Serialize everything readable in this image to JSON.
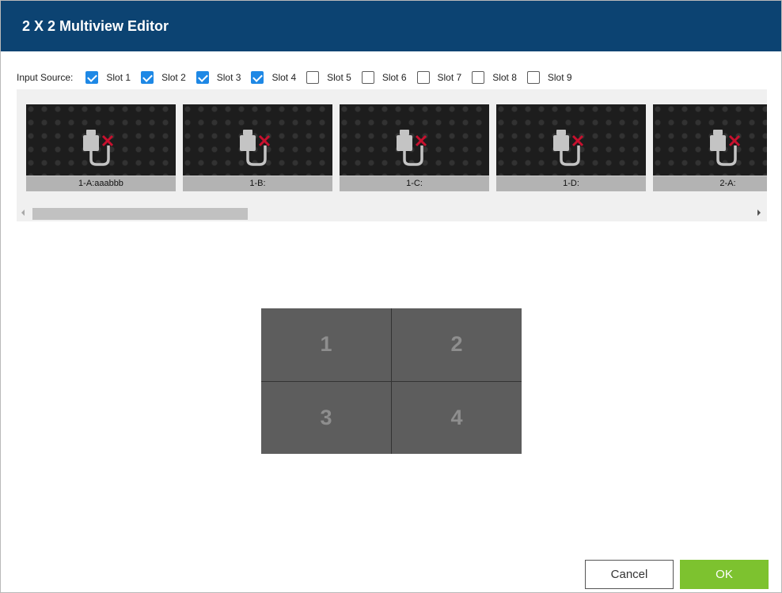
{
  "dialog": {
    "title": "2 X 2 Multiview Editor"
  },
  "input_source": {
    "label": "Input Source:",
    "slots": [
      {
        "label": "Slot 1",
        "checked": true
      },
      {
        "label": "Slot 2",
        "checked": true
      },
      {
        "label": "Slot 3",
        "checked": true
      },
      {
        "label": "Slot 4",
        "checked": true
      },
      {
        "label": "Slot 5",
        "checked": false
      },
      {
        "label": "Slot 6",
        "checked": false
      },
      {
        "label": "Slot 7",
        "checked": false
      },
      {
        "label": "Slot 8",
        "checked": false
      },
      {
        "label": "Slot 9",
        "checked": false
      }
    ]
  },
  "sources": [
    {
      "label": "1-A:aaabbb",
      "icon": "disconnected-cable-icon"
    },
    {
      "label": "1-B:",
      "icon": "disconnected-cable-icon"
    },
    {
      "label": "1-C:",
      "icon": "disconnected-cable-icon"
    },
    {
      "label": "1-D:",
      "icon": "disconnected-cable-icon"
    },
    {
      "label": "2-A:",
      "icon": "disconnected-cable-icon"
    }
  ],
  "layout": {
    "cells": [
      "1",
      "2",
      "3",
      "4"
    ]
  },
  "buttons": {
    "cancel": "Cancel",
    "ok": "OK"
  },
  "colors": {
    "title_bar": "#0c4372",
    "checkbox_checked": "#1e88e5",
    "ok_button": "#7dc22f",
    "no_signal_x": "#c8102e",
    "layout_cell": "#5d5d5d"
  }
}
